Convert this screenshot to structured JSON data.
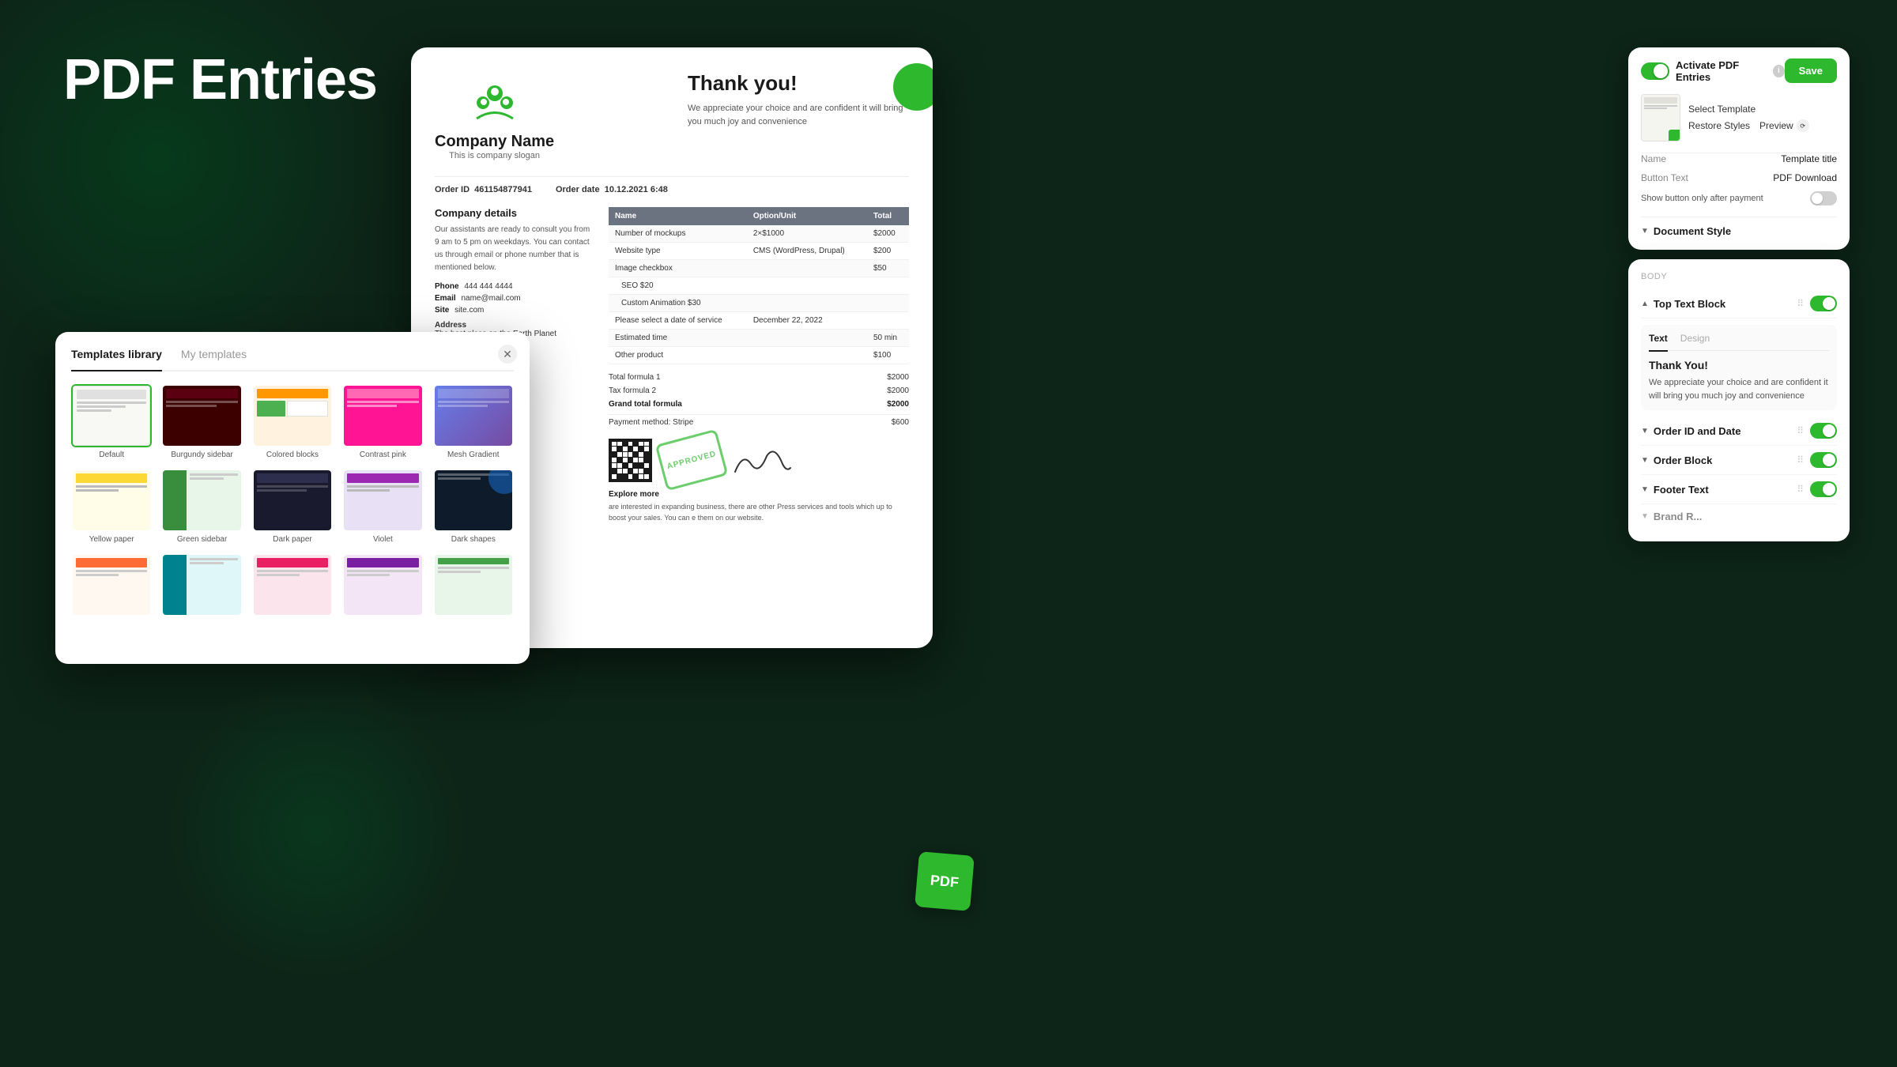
{
  "page": {
    "title": "PDF Entries",
    "background": "#0d2418"
  },
  "pdf_preview": {
    "company_name": "Company Name",
    "company_slogan": "This is company slogan",
    "thank_you_heading": "Thank you!",
    "thank_you_text": "We appreciate your choice and are confident it will bring you much joy and convenience",
    "order_id_label": "Order ID",
    "order_id_value": "461154877941",
    "order_date_label": "Order date",
    "order_date_value": "10.12.2021 6:48",
    "company_details_heading": "Company details",
    "company_details_text": "Our assistants are ready to consult you from 9 am to 5 pm on weekdays. You can contact us through email or phone number that is mentioned below.",
    "phone_label": "Phone",
    "phone_value": "444 444 4444",
    "email_label": "Email",
    "email_value": "name@mail.com",
    "site_label": "Site",
    "site_value": "site.com",
    "address_label": "Address",
    "address_value": "The best place on the Earth Planet",
    "table_headers": [
      "Name",
      "Option/Unit",
      "Total"
    ],
    "table_rows": [
      [
        "Number of mockups",
        "2×$1000",
        "$2000"
      ],
      [
        "Website type",
        "CMS (WordPress, Drupal)",
        "$200"
      ],
      [
        "Image checkbox",
        "",
        "$50"
      ],
      [
        "SEO $20",
        "",
        ""
      ],
      [
        "Custom Animation $30",
        "",
        ""
      ],
      [
        "Please select a date of service",
        "December 22, 2022",
        ""
      ],
      [
        "Estimated time",
        "",
        "50 min"
      ],
      [
        "Other product",
        "",
        "$100"
      ],
      [
        "Total formula 1",
        "",
        "$2000"
      ],
      [
        "Tax formula 2",
        "",
        "$2000"
      ],
      [
        "Grand total formula",
        "",
        "$2000"
      ],
      [
        "Payment method: Stripe",
        "",
        "$600"
      ]
    ],
    "explore_more_heading": "Explore more",
    "approved_text": "APPROVED"
  },
  "templates_modal": {
    "tab1": "Templates library",
    "tab2": "My templates",
    "templates": [
      {
        "name": "Default",
        "style": "default"
      },
      {
        "name": "Burgundy sidebar",
        "style": "burgundy"
      },
      {
        "name": "Colored blocks",
        "style": "colored"
      },
      {
        "name": "Contrast pink",
        "style": "contrast-pink"
      },
      {
        "name": "Mesh Gradient",
        "style": "mesh"
      },
      {
        "name": "Yellow paper",
        "style": "yellow"
      },
      {
        "name": "Green sidebar",
        "style": "green"
      },
      {
        "name": "Dark paper",
        "style": "dark"
      },
      {
        "name": "Violet",
        "style": "violet"
      },
      {
        "name": "Dark shapes",
        "style": "dark-shapes"
      },
      {
        "name": "",
        "style": "row3-1"
      },
      {
        "name": "",
        "style": "row3-2"
      },
      {
        "name": "",
        "style": "row3-3"
      },
      {
        "name": "",
        "style": "row3-4"
      },
      {
        "name": "",
        "style": "row3-5"
      }
    ]
  },
  "right_panel": {
    "activate_label": "Activate PDF Entries",
    "save_label": "Save",
    "select_template_label": "Select Template",
    "restore_styles_label": "Restore Styles",
    "preview_label": "Preview",
    "name_label": "Name",
    "name_value": "Template title",
    "button_text_label": "Button Text",
    "button_text_value": "PDF Download",
    "show_button_label": "Show button only after payment",
    "document_style_label": "Document Style",
    "body_label": "Body",
    "top_text_block_label": "Top Text Block",
    "text_tab": "Text",
    "design_tab": "Design",
    "thank_you_heading": "Thank You!",
    "thank_you_body": "We appreciate your choice and are confident it will bring you much joy and convenience",
    "order_id_date_label": "Order ID and Date",
    "order_block_label": "Order Block",
    "footer_text_label": "Footer Text",
    "brand_label": "Brand R..."
  },
  "pdf_badge": {
    "text": "PDF"
  }
}
